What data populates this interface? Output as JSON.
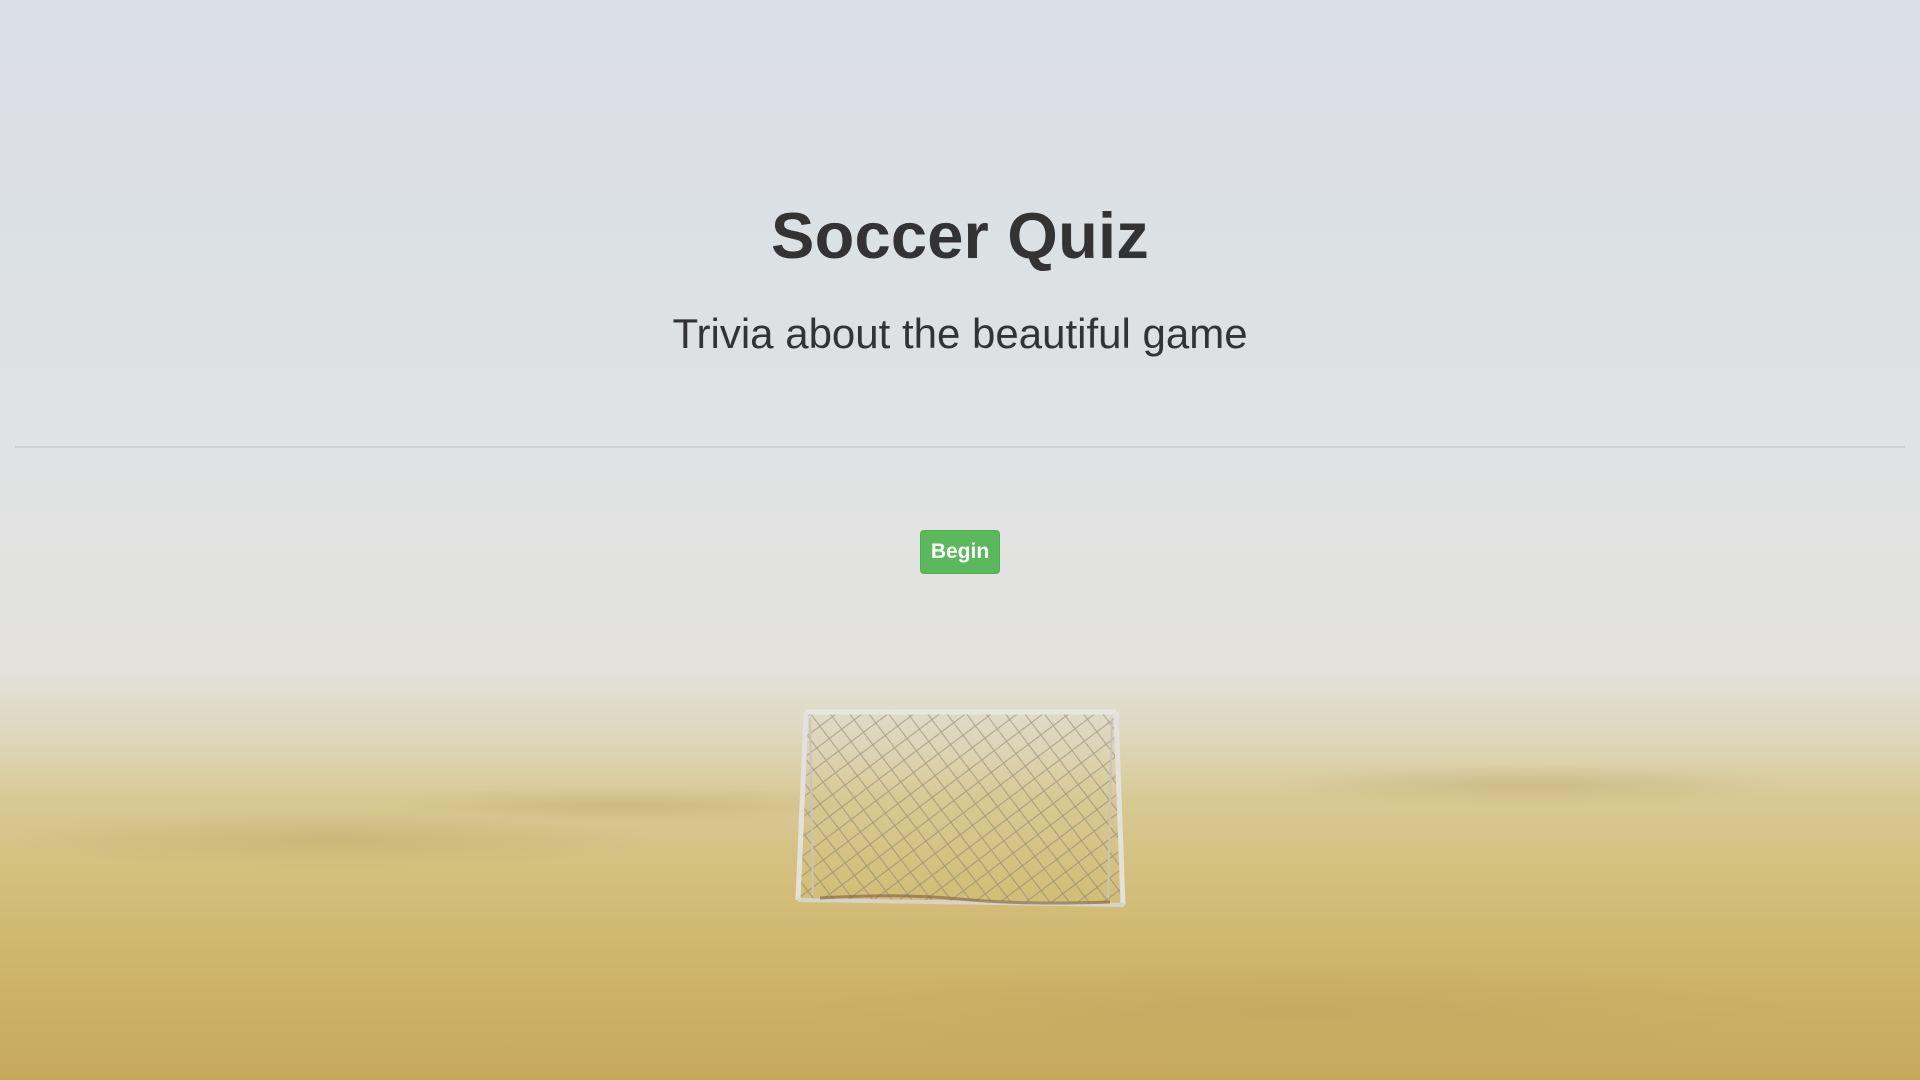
{
  "header": {
    "title": "Soccer Quiz",
    "subtitle": "Trivia about the beautiful game"
  },
  "actions": {
    "begin_label": "Begin"
  },
  "background": {
    "description_icon": "soccer-goal-in-fog-photo"
  },
  "colors": {
    "begin_button": "#5cb85c",
    "text": "#333333"
  }
}
